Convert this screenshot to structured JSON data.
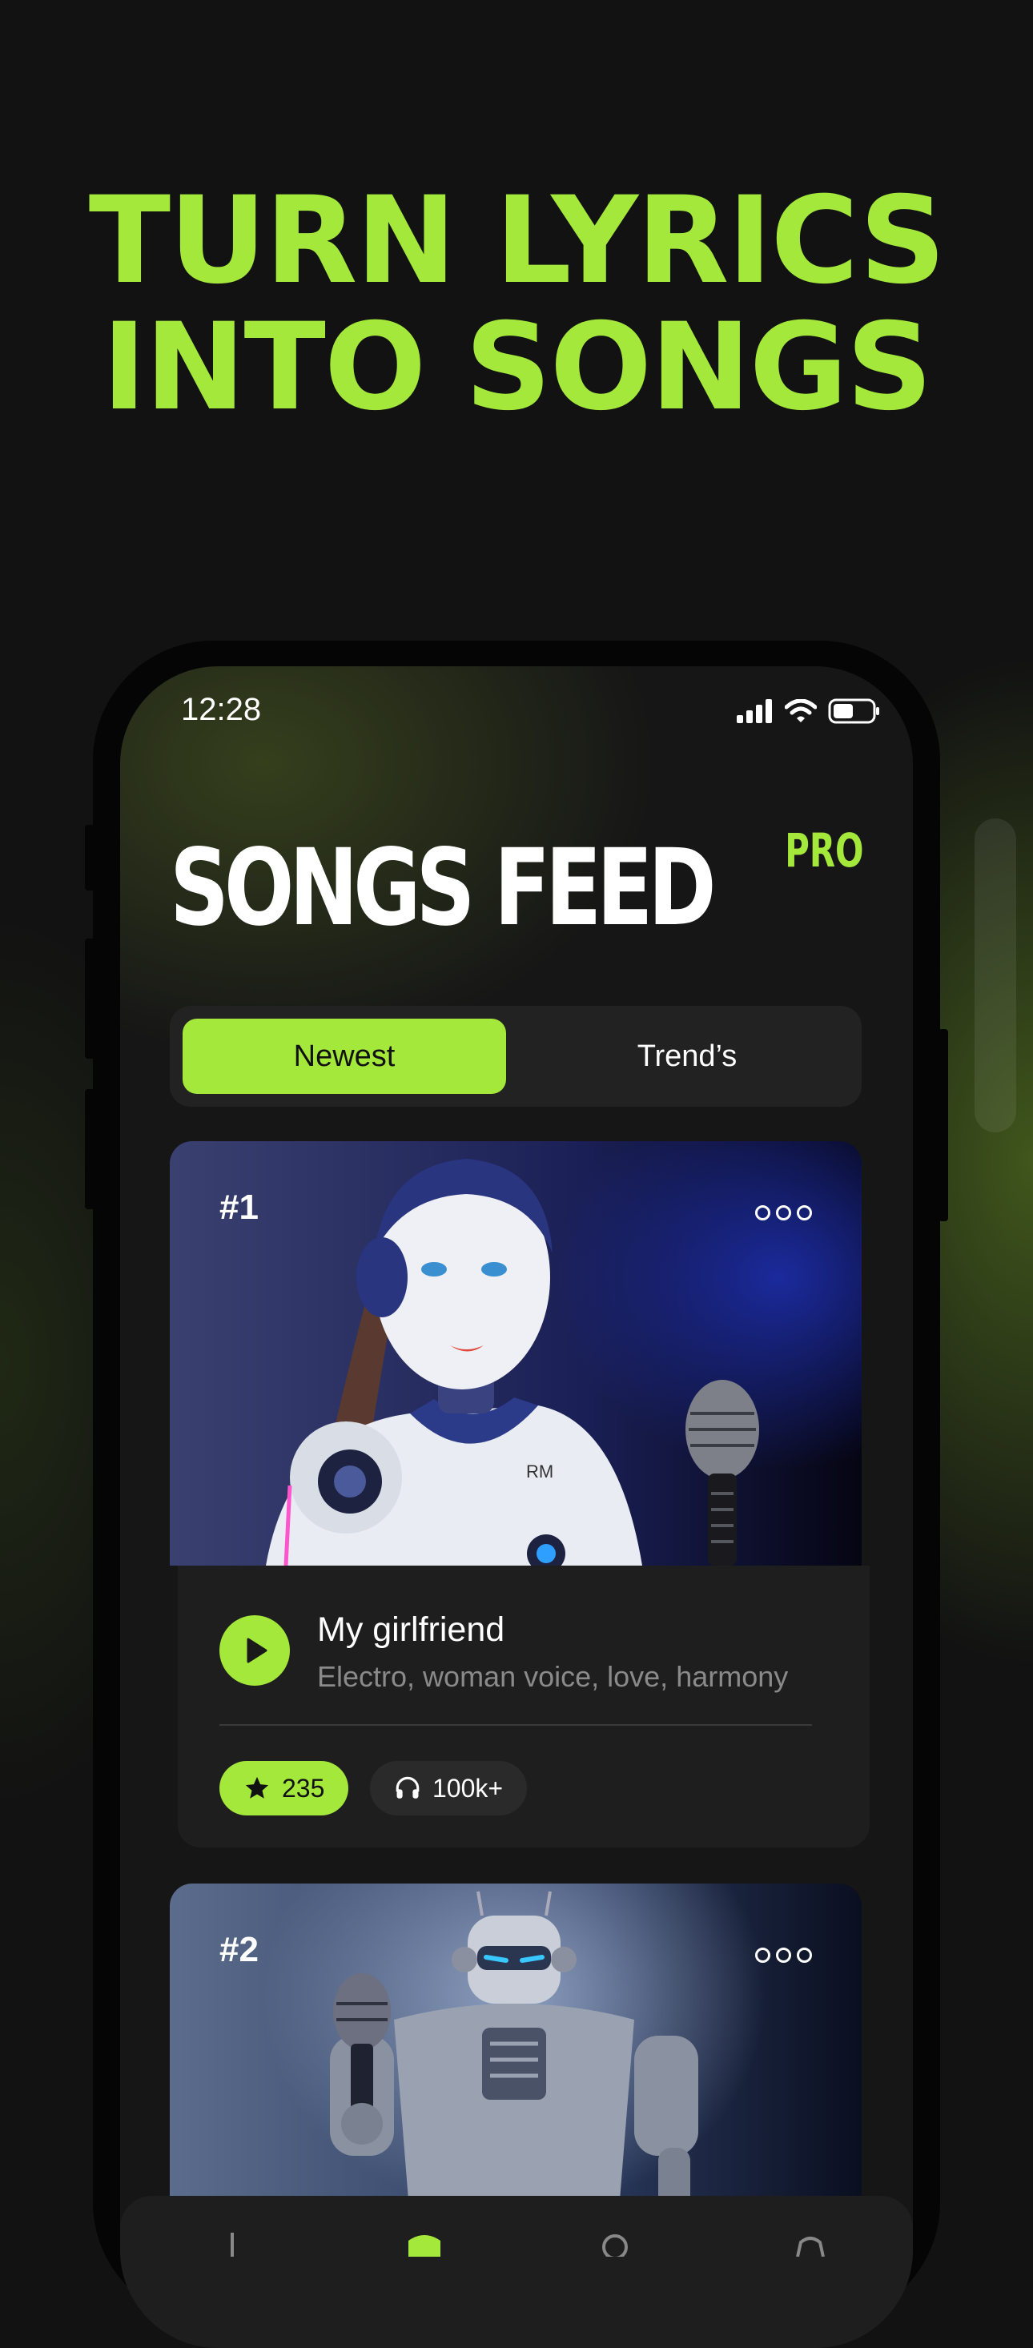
{
  "headline": {
    "line1": "TURN LYRICS",
    "line2": "INTO SONGS"
  },
  "colors": {
    "accent": "#a4e83b",
    "background": "#121212",
    "card": "#1e1e1e"
  },
  "status_bar": {
    "time": "12:28",
    "icons": [
      "signal-icon",
      "wifi-icon",
      "battery-icon"
    ]
  },
  "screen": {
    "title": "SONGS FEED",
    "pro_label": "PRO",
    "tabs": [
      {
        "label": "Newest",
        "active": true
      },
      {
        "label": "Trend’s",
        "active": false
      }
    ]
  },
  "songs": [
    {
      "rank": "#1",
      "title": "My girlfriend",
      "tags": "Electro, woman voice, love, harmony",
      "rating": "235",
      "listens": "100k+"
    },
    {
      "rank": "#2"
    }
  ],
  "tabbar": {
    "icons": [
      "chart-icon",
      "feed-icon",
      "mic-icon",
      "settings-icon"
    ]
  }
}
